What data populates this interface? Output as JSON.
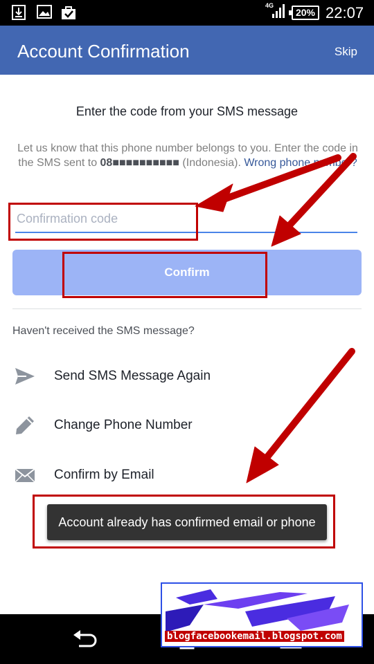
{
  "status_bar": {
    "network": "4G",
    "battery": "20%",
    "time": "22:07",
    "left_icons": [
      "download-icon",
      "image-icon",
      "bag-check-icon"
    ],
    "right_icons": [
      "signal-icon",
      "battery-icon"
    ]
  },
  "app_bar": {
    "title": "Account Confirmation",
    "skip_label": "Skip",
    "color": "#4267b2"
  },
  "main": {
    "heading": "Enter the code from your SMS message",
    "description_before": "Let us know that this phone number belongs to you. Enter the code in the SMS sent to ",
    "phone_number": "08■■■■■■■■■■",
    "description_after": " (Indonesia). ",
    "wrong_number_link": "Wrong phone number?",
    "code_input": {
      "value": "",
      "placeholder": "Confirmation code"
    },
    "confirm_label": "Confirm",
    "confirm_color": "#9cb4f6",
    "resend_prompt": "Haven't received the SMS message?",
    "options": [
      {
        "label": "Send SMS Message Again",
        "icon": "send-icon"
      },
      {
        "label": "Change Phone Number",
        "icon": "pencil-icon"
      },
      {
        "label": "Confirm by Email",
        "icon": "envelope-icon"
      }
    ]
  },
  "toast": {
    "message": "Account already has confirmed email or phone"
  },
  "annotations": {
    "color": "#c00000"
  },
  "nav_bar": {
    "icons": [
      "back-icon",
      "home-icon",
      "recent-apps-icon"
    ]
  },
  "watermark": {
    "text": "blogfacebookemail.blogspot.com"
  }
}
